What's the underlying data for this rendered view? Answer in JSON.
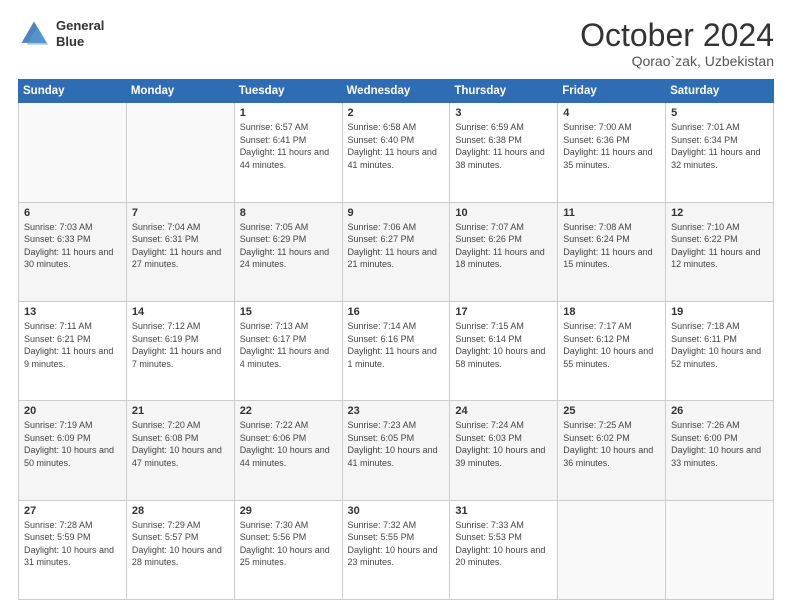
{
  "header": {
    "logo_line1": "General",
    "logo_line2": "Blue",
    "month_year": "October 2024",
    "location": "Qorao`zak, Uzbekistan"
  },
  "weekdays": [
    "Sunday",
    "Monday",
    "Tuesday",
    "Wednesday",
    "Thursday",
    "Friday",
    "Saturday"
  ],
  "weeks": [
    [
      {
        "day": "",
        "info": ""
      },
      {
        "day": "",
        "info": ""
      },
      {
        "day": "1",
        "info": "Sunrise: 6:57 AM\nSunset: 6:41 PM\nDaylight: 11 hours and 44 minutes."
      },
      {
        "day": "2",
        "info": "Sunrise: 6:58 AM\nSunset: 6:40 PM\nDaylight: 11 hours and 41 minutes."
      },
      {
        "day": "3",
        "info": "Sunrise: 6:59 AM\nSunset: 6:38 PM\nDaylight: 11 hours and 38 minutes."
      },
      {
        "day": "4",
        "info": "Sunrise: 7:00 AM\nSunset: 6:36 PM\nDaylight: 11 hours and 35 minutes."
      },
      {
        "day": "5",
        "info": "Sunrise: 7:01 AM\nSunset: 6:34 PM\nDaylight: 11 hours and 32 minutes."
      }
    ],
    [
      {
        "day": "6",
        "info": "Sunrise: 7:03 AM\nSunset: 6:33 PM\nDaylight: 11 hours and 30 minutes."
      },
      {
        "day": "7",
        "info": "Sunrise: 7:04 AM\nSunset: 6:31 PM\nDaylight: 11 hours and 27 minutes."
      },
      {
        "day": "8",
        "info": "Sunrise: 7:05 AM\nSunset: 6:29 PM\nDaylight: 11 hours and 24 minutes."
      },
      {
        "day": "9",
        "info": "Sunrise: 7:06 AM\nSunset: 6:27 PM\nDaylight: 11 hours and 21 minutes."
      },
      {
        "day": "10",
        "info": "Sunrise: 7:07 AM\nSunset: 6:26 PM\nDaylight: 11 hours and 18 minutes."
      },
      {
        "day": "11",
        "info": "Sunrise: 7:08 AM\nSunset: 6:24 PM\nDaylight: 11 hours and 15 minutes."
      },
      {
        "day": "12",
        "info": "Sunrise: 7:10 AM\nSunset: 6:22 PM\nDaylight: 11 hours and 12 minutes."
      }
    ],
    [
      {
        "day": "13",
        "info": "Sunrise: 7:11 AM\nSunset: 6:21 PM\nDaylight: 11 hours and 9 minutes."
      },
      {
        "day": "14",
        "info": "Sunrise: 7:12 AM\nSunset: 6:19 PM\nDaylight: 11 hours and 7 minutes."
      },
      {
        "day": "15",
        "info": "Sunrise: 7:13 AM\nSunset: 6:17 PM\nDaylight: 11 hours and 4 minutes."
      },
      {
        "day": "16",
        "info": "Sunrise: 7:14 AM\nSunset: 6:16 PM\nDaylight: 11 hours and 1 minute."
      },
      {
        "day": "17",
        "info": "Sunrise: 7:15 AM\nSunset: 6:14 PM\nDaylight: 10 hours and 58 minutes."
      },
      {
        "day": "18",
        "info": "Sunrise: 7:17 AM\nSunset: 6:12 PM\nDaylight: 10 hours and 55 minutes."
      },
      {
        "day": "19",
        "info": "Sunrise: 7:18 AM\nSunset: 6:11 PM\nDaylight: 10 hours and 52 minutes."
      }
    ],
    [
      {
        "day": "20",
        "info": "Sunrise: 7:19 AM\nSunset: 6:09 PM\nDaylight: 10 hours and 50 minutes."
      },
      {
        "day": "21",
        "info": "Sunrise: 7:20 AM\nSunset: 6:08 PM\nDaylight: 10 hours and 47 minutes."
      },
      {
        "day": "22",
        "info": "Sunrise: 7:22 AM\nSunset: 6:06 PM\nDaylight: 10 hours and 44 minutes."
      },
      {
        "day": "23",
        "info": "Sunrise: 7:23 AM\nSunset: 6:05 PM\nDaylight: 10 hours and 41 minutes."
      },
      {
        "day": "24",
        "info": "Sunrise: 7:24 AM\nSunset: 6:03 PM\nDaylight: 10 hours and 39 minutes."
      },
      {
        "day": "25",
        "info": "Sunrise: 7:25 AM\nSunset: 6:02 PM\nDaylight: 10 hours and 36 minutes."
      },
      {
        "day": "26",
        "info": "Sunrise: 7:26 AM\nSunset: 6:00 PM\nDaylight: 10 hours and 33 minutes."
      }
    ],
    [
      {
        "day": "27",
        "info": "Sunrise: 7:28 AM\nSunset: 5:59 PM\nDaylight: 10 hours and 31 minutes."
      },
      {
        "day": "28",
        "info": "Sunrise: 7:29 AM\nSunset: 5:57 PM\nDaylight: 10 hours and 28 minutes."
      },
      {
        "day": "29",
        "info": "Sunrise: 7:30 AM\nSunset: 5:56 PM\nDaylight: 10 hours and 25 minutes."
      },
      {
        "day": "30",
        "info": "Sunrise: 7:32 AM\nSunset: 5:55 PM\nDaylight: 10 hours and 23 minutes."
      },
      {
        "day": "31",
        "info": "Sunrise: 7:33 AM\nSunset: 5:53 PM\nDaylight: 10 hours and 20 minutes."
      },
      {
        "day": "",
        "info": ""
      },
      {
        "day": "",
        "info": ""
      }
    ]
  ]
}
